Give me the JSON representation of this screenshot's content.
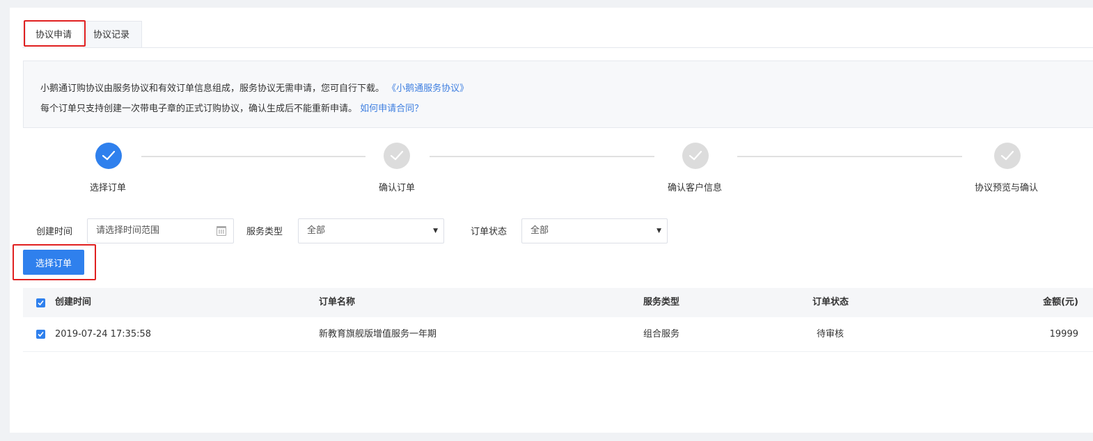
{
  "tabs": [
    {
      "label": "协议申请",
      "active": true
    },
    {
      "label": "协议记录",
      "active": false
    }
  ],
  "notice": {
    "line1_text": "小鹅通订购协议由服务协议和有效订单信息组成，服务协议无需申请，您可自行下载。",
    "line1_link": "《小鹅通服务协议》",
    "line2_text": "每个订单只支持创建一次带电子章的正式订购协议，确认生成后不能重新申请。",
    "line2_link": "如何申请合同？"
  },
  "steps": [
    {
      "label": "选择订单",
      "status": "active"
    },
    {
      "label": "确认订单",
      "status": "pending"
    },
    {
      "label": "确认客户信息",
      "status": "pending"
    },
    {
      "label": "协议预览与确认",
      "status": "pending"
    }
  ],
  "filters": {
    "created_time_label": "创建时间",
    "created_time_placeholder": "请选择时间范围",
    "service_type_label": "服务类型",
    "service_type_value": "全部",
    "order_status_label": "订单状态",
    "order_status_value": "全部"
  },
  "select_order_button": "选择订单",
  "table": {
    "columns": [
      "创建时间",
      "订单名称",
      "服务类型",
      "订单状态",
      "金额(元)"
    ],
    "rows": [
      {
        "created_time": "2019-07-24 17:35:58",
        "order_name": "新教育旗舰版增值服务一年期",
        "service_type": "组合服务",
        "order_status": "待审核",
        "amount": "19999",
        "checked": true
      }
    ],
    "header_checked": true
  },
  "colors": {
    "primary": "#2f80ed",
    "highlight": "#e02020",
    "link": "#3f7fe0"
  }
}
